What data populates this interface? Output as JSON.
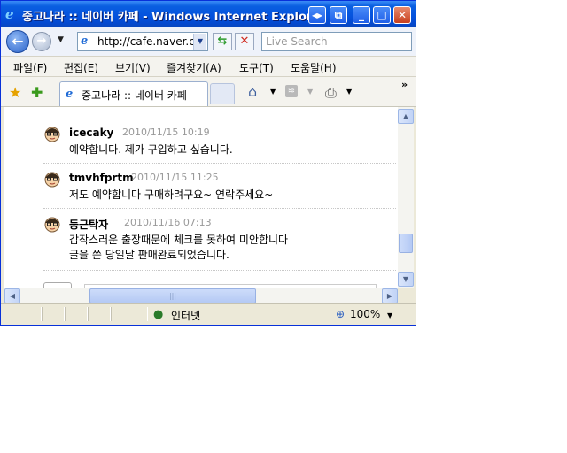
{
  "window": {
    "title": "중고나라 :: 네이버 카페 - Windows Internet Explorer",
    "btn_restore_icon": "◂▸",
    "btn_min_icon": "_",
    "btn_max_icon": "□",
    "btn_close_icon": "✕"
  },
  "address": {
    "url": "http://cafe.naver.com/joonggonara",
    "search_placeholder": "Live Search"
  },
  "menu": [
    "파일(F)",
    "편집(E)",
    "보기(V)",
    "즐겨찾기(A)",
    "도구(T)",
    "도움말(H)"
  ],
  "tab": {
    "label": "중고나라 :: 네이버 카페"
  },
  "comments": [
    {
      "author": "icecaky",
      "date": "2010/11/15 10:19",
      "lines": [
        "예약합니다. 제가 구입하고 싶습니다."
      ]
    },
    {
      "author": "tmvhfprtm",
      "date": "2010/11/15 11:25",
      "lines": [
        "저도 예약합니다 구매하려구요~ 연락주세요~"
      ]
    },
    {
      "author": "둥근탁자",
      "date": "2010/11/16 07:13",
      "lines": [
        "갑작스러운 출장때문에 체크를 못하여 미안합니다",
        "글을 쓴 당일날 판매완료되었습니다."
      ]
    }
  ],
  "status": {
    "zone": "인터넷",
    "zoom": "100%"
  }
}
